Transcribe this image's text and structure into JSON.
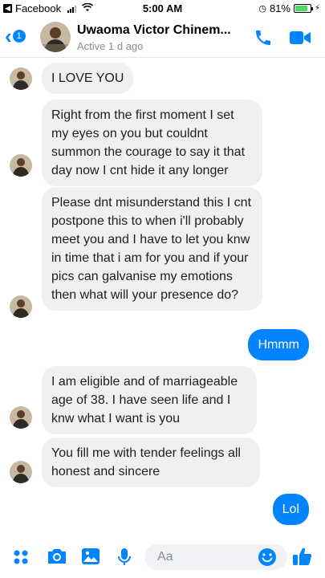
{
  "status_bar": {
    "carrier": "Facebook",
    "time": "5:00 AM",
    "battery": "81%",
    "battery_level": 0.81
  },
  "header": {
    "unread_count": "1",
    "contact_name": "Uwaoma Victor Chinem...",
    "active_status": "Active 1 d ago"
  },
  "messages": [
    {
      "sender": "contact",
      "text": "I LOVE YOU"
    },
    {
      "sender": "contact",
      "text": "Right from the first moment I set my eyes on you but couldnt summon the courage to say it that day now I cnt hide it any longer"
    },
    {
      "sender": "contact",
      "text": "Please dnt misunderstand this I cnt postpone this to when i'll probably meet you and I have to let you knw in time that i am for you and if your pics can galvanise my emotions then what will your presence do?"
    },
    {
      "sender": "me",
      "text": "Hmmm"
    },
    {
      "sender": "contact",
      "text": "I am eligible and of marriageable age of 38. I have seen life and I knw what I want is you"
    },
    {
      "sender": "contact",
      "text": "You fill me with tender feelings all honest and sincere"
    },
    {
      "sender": "me",
      "text": "Lol"
    }
  ],
  "composer": {
    "placeholder": "Aa"
  },
  "colors": {
    "accent": "#0084ff",
    "received_bubble": "#f1f0f0",
    "sent_bubble": "#0084ff"
  }
}
